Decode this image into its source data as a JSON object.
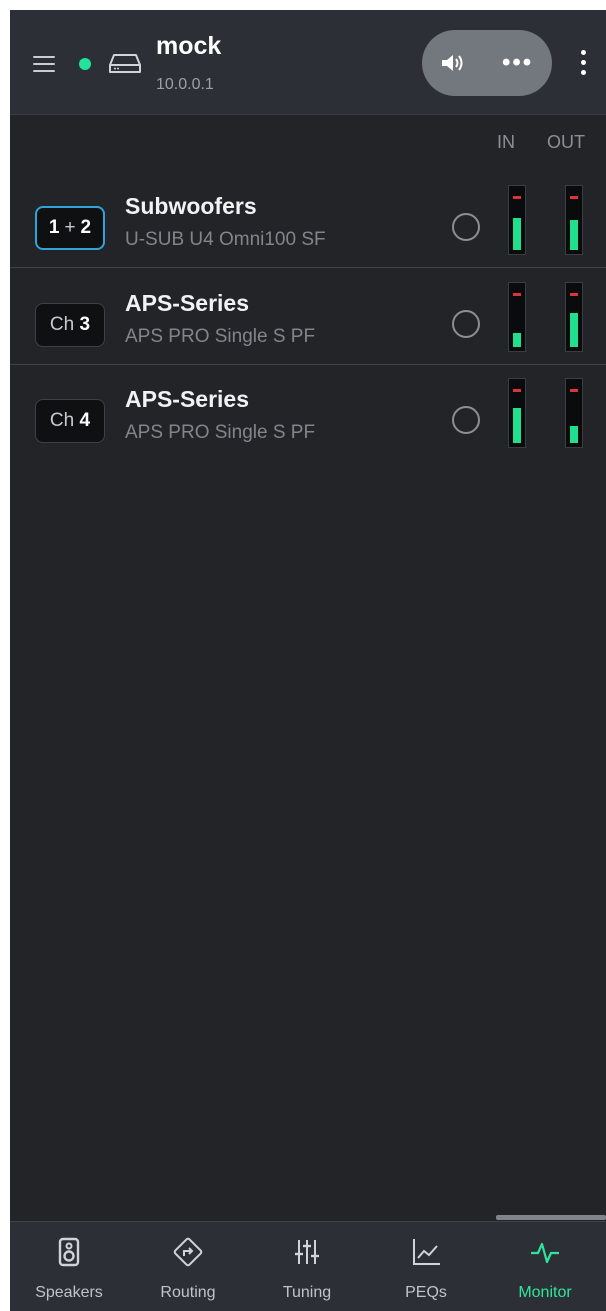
{
  "header": {
    "device_name": "mock",
    "device_ip": "10.0.0.1",
    "status": "online",
    "colors": {
      "status": "#22e39a",
      "accent": "#2ee59b",
      "selected_border": "#2ea4d8"
    }
  },
  "columns": {
    "in_label": "IN",
    "out_label": "OUT"
  },
  "rows": [
    {
      "badge_prefix": "",
      "badge_main": "1",
      "badge_joiner": "+",
      "badge_extra": "2",
      "title": "Subwoofers",
      "subtitle": "U-SUB U4 Omni100 SF",
      "selected": true,
      "in_level": 0.52,
      "out_level": 0.48
    },
    {
      "badge_prefix": "Ch ",
      "badge_main": "3",
      "badge_joiner": "",
      "badge_extra": "",
      "title": "APS-Series",
      "subtitle": "APS PRO Single S PF",
      "selected": false,
      "in_level": 0.22,
      "out_level": 0.55
    },
    {
      "badge_prefix": "Ch ",
      "badge_main": "4",
      "badge_joiner": "",
      "badge_extra": "",
      "title": "APS-Series",
      "subtitle": "APS PRO Single S PF",
      "selected": false,
      "in_level": 0.57,
      "out_level": 0.27
    }
  ],
  "tabs": [
    {
      "label": "Speakers",
      "icon": "speaker-icon",
      "active": false
    },
    {
      "label": "Routing",
      "icon": "routing-icon",
      "active": false
    },
    {
      "label": "Tuning",
      "icon": "sliders-icon",
      "active": false
    },
    {
      "label": "PEQs",
      "icon": "chart-icon",
      "active": false
    },
    {
      "label": "Monitor",
      "icon": "pulse-icon",
      "active": true
    }
  ]
}
